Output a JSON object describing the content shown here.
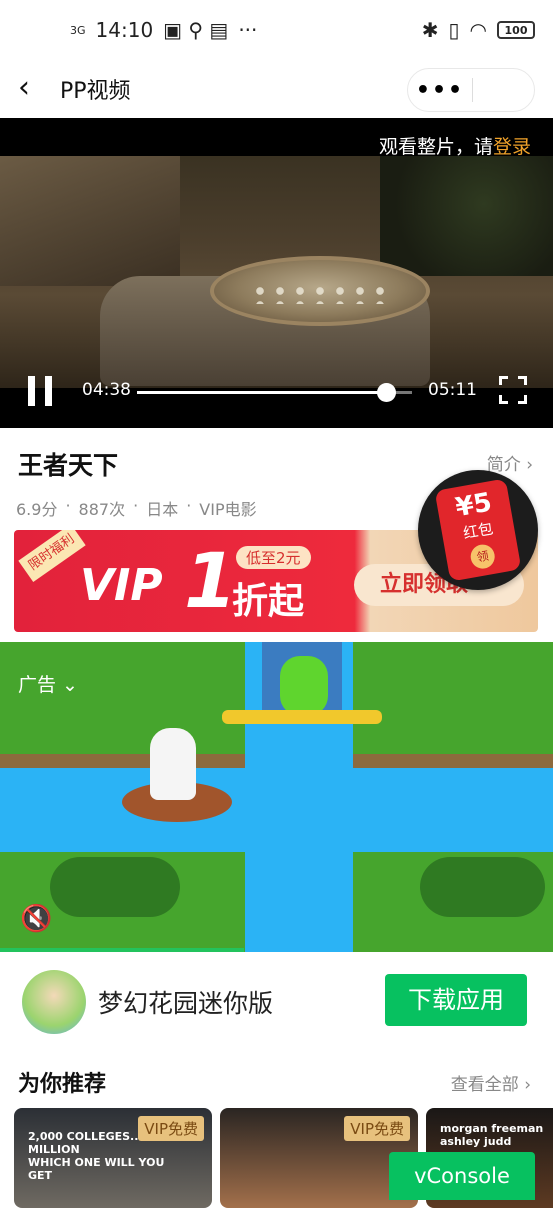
{
  "status_bar": {
    "network": "3G",
    "time": "14:10",
    "battery": "100",
    "more": "···"
  },
  "nav": {
    "back": "‹",
    "title": "PP视频",
    "menu": "•••"
  },
  "player": {
    "login_prompt": "观看整片，请",
    "login_link": "登录",
    "current_time": "04:38",
    "total_time": "05:11",
    "progress": 0.907
  },
  "movie": {
    "title": "王者天下",
    "intro_link": "简介 ›",
    "rating": "6.9分",
    "views": "887次",
    "country": "日本",
    "category": "VIP电影",
    "sep": "·"
  },
  "red_packet": {
    "amount": "¥5",
    "label": "红包",
    "seal": "领"
  },
  "banner": {
    "corner_tag": "限时福利",
    "vip": "VIP",
    "number": "1",
    "low": "低至2元",
    "discount": "折起",
    "cta": "立即领取"
  },
  "ad": {
    "label": "广告 ⌄",
    "mute_icon": "🔇"
  },
  "app_promo": {
    "name": "梦幻花园迷你版",
    "download": "下载应用"
  },
  "recommend": {
    "heading": "为你推荐",
    "view_all": "查看全部 ›",
    "cards": [
      {
        "badge": "VIP免费",
        "caption": "2,000 COLLEGES... 1 MILLION\nWHICH ONE WILL YOU GET"
      },
      {
        "badge": "VIP免费",
        "caption": ""
      },
      {
        "badge": "",
        "caption": "morgan freeman\nashley judd"
      }
    ]
  },
  "vconsole": "vConsole",
  "colors": {
    "accent_green": "#07c160",
    "login_orange": "#f0a22a",
    "banner_red": "#e2223b"
  }
}
